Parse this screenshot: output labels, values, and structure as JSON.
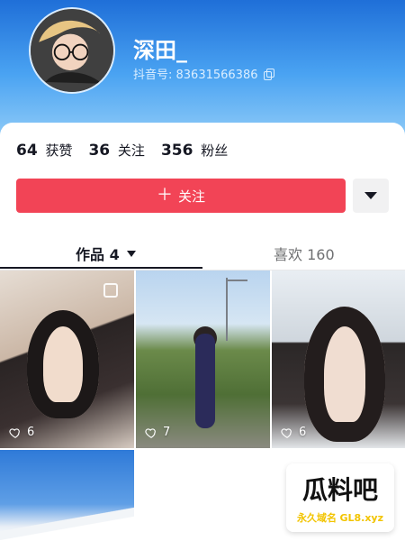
{
  "profile": {
    "name": "深田_",
    "douyin_id": "抖音号: 83631566386"
  },
  "stats": [
    {
      "value": "64",
      "label": "获赞"
    },
    {
      "value": "36",
      "label": "关注"
    },
    {
      "value": "356",
      "label": "粉丝"
    }
  ],
  "actions": {
    "follow_label": "关注",
    "follow_plus": "＋"
  },
  "tabs": {
    "works_label": "作品 4",
    "likes_label": "喜欢 160"
  },
  "posts": [
    {
      "likes": "6"
    },
    {
      "likes": "7"
    },
    {
      "likes": "6"
    }
  ],
  "watermark": {
    "title": "瓜料吧",
    "subtitle_prefix": "永久域名",
    "subtitle_domain": "GL8.xyz"
  },
  "colors": {
    "follow_red": "#f24456",
    "hero_blue": "#1f6fd8"
  },
  "icons": {
    "copy": "copy-icon",
    "dropdown": "triangle-down-icon",
    "heart": "heart-outline-icon"
  }
}
